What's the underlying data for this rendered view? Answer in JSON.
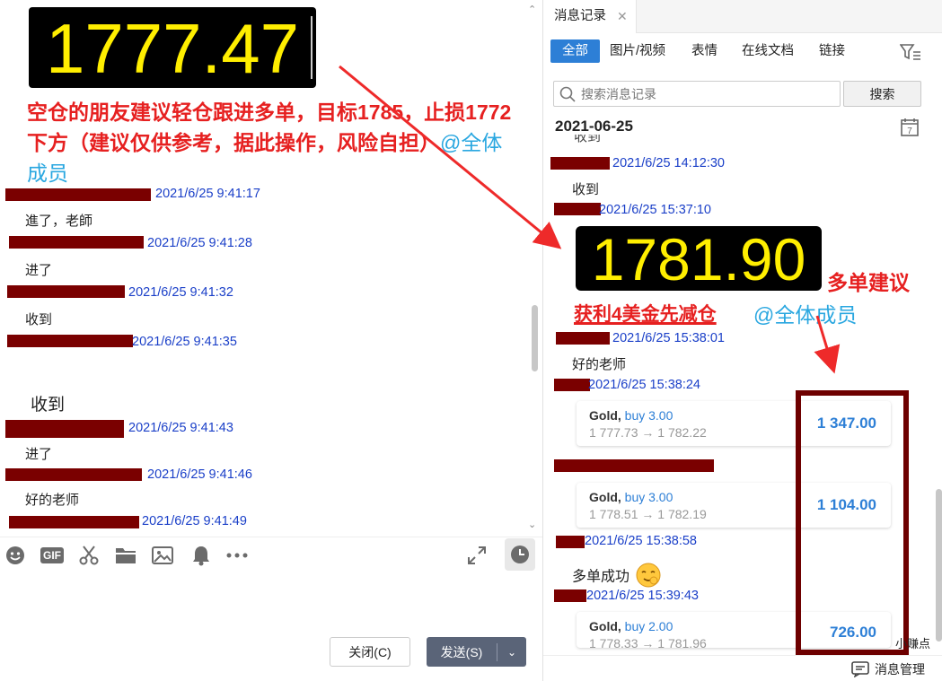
{
  "left": {
    "price": "1777.47",
    "advice_text": "空仓的朋友建议轻仓跟进多单，目标1785，止损1772下方（建议仅供参考，据此操作，风险自担）",
    "advice_at": "@全体成员",
    "messages": [
      {
        "time": "2021/6/25 9:41:17",
        "text": "進了，老師"
      },
      {
        "time": "2021/6/25 9:41:28",
        "text": "进了"
      },
      {
        "time": "2021/6/25 9:41:32",
        "text": "收到"
      },
      {
        "time": "2021/6/25 9:41:35",
        "text": "收到"
      },
      {
        "time": "2021/6/25 9:41:43",
        "text": "进了"
      },
      {
        "time": "2021/6/25 9:41:46",
        "text": "好的老师"
      },
      {
        "time": "2021/6/25 9:41:49",
        "text": ""
      }
    ],
    "toolbar_icons": [
      "smiley-icon",
      "gif-icon",
      "scissors-icon",
      "folder-icon",
      "image-icon",
      "bell-icon",
      "more-icon",
      "expand-icon",
      "clock-icon"
    ],
    "gif_label": "GIF",
    "close_label": "关闭(C)",
    "send_label": "发送(S)"
  },
  "right": {
    "tab_label": "消息记录",
    "filters": [
      "全部",
      "图片/视频",
      "表情",
      "在线文档",
      "链接"
    ],
    "search_placeholder": "搜索消息记录",
    "search_button": "搜索",
    "date": "2021-06-25",
    "calendar_day": "7",
    "partial_text": "收到",
    "messages": [
      {
        "time": "2021/6/25 14:12:30",
        "text": "收到"
      },
      {
        "time": "2021/6/25 15:37:10"
      },
      {
        "time": "2021/6/25 15:38:01",
        "text": "好的老师"
      },
      {
        "time": "2021/6/25 15:38:24"
      },
      {
        "time": "2021/6/25 15:38:58",
        "text": "多单成功"
      },
      {
        "time": "2021/6/25 15:39:43"
      }
    ],
    "price": "1781.90",
    "buy_label": "多单建议",
    "profit_label": "获利4美金先减仓",
    "profit_at": "@全体成员",
    "cards": [
      {
        "symbol": "Gold,",
        "side": "buy 3.00",
        "prices": "1 777.73 → 1 782.22",
        "pl": "1 347.00"
      },
      {
        "symbol": "Gold,",
        "side": "buy 3.00",
        "prices": "1 778.51 → 1 782.19",
        "pl": "1 104.00"
      },
      {
        "symbol": "Gold,",
        "side": "buy 2.00",
        "prices": "1 778.33 → 1 781.96",
        "pl": "726.00"
      }
    ],
    "watermark": "小赚点",
    "manage_label": "消息管理"
  },
  "colors": {
    "accent_blue": "#2d7fd6",
    "timestamp_blue": "#1a3fc8",
    "annotation_red": "#e62020",
    "redaction": "#7a0000",
    "price_yellow": "#ffee00"
  }
}
